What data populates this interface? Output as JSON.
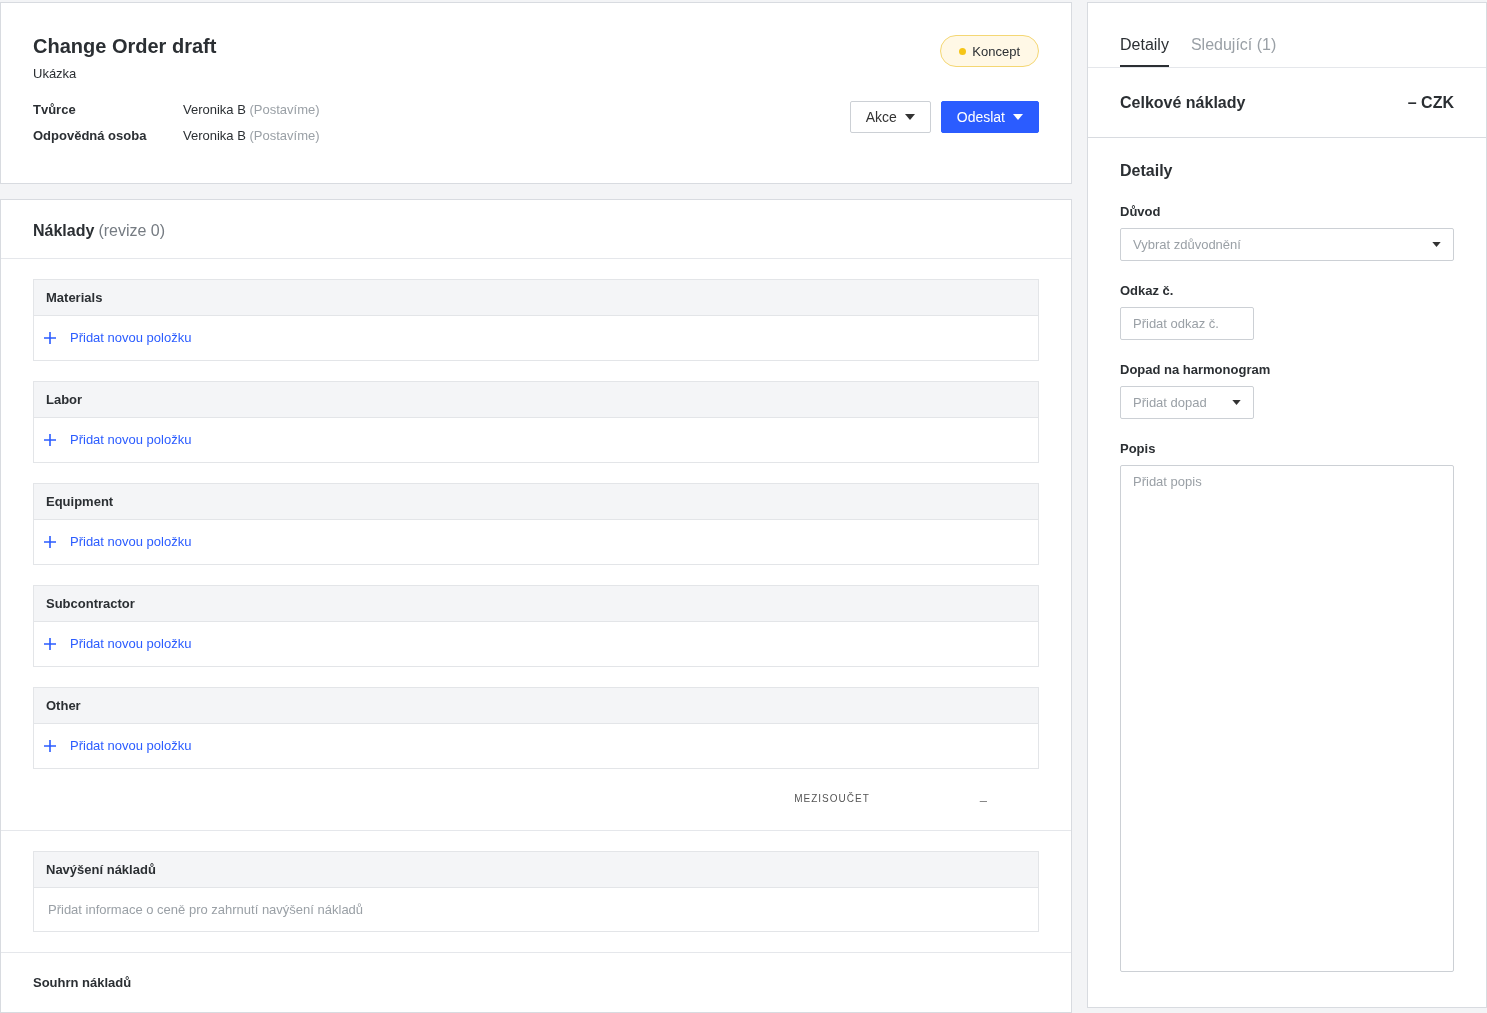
{
  "header": {
    "title": "Change Order draft",
    "subtitle": "Ukázka",
    "status": {
      "label": "Koncept",
      "color": "#f5c518"
    },
    "people": [
      {
        "label": "Tvůrce",
        "name": "Veronika B",
        "company": "(Postavíme)"
      },
      {
        "label": "Odpovědná osoba",
        "name": "Veronika B",
        "company": "(Postavíme)"
      }
    ],
    "buttons": [
      {
        "label": "Akce",
        "kind": "secondary"
      },
      {
        "label": "Odeslat",
        "kind": "primary"
      }
    ]
  },
  "costs": {
    "title": "Náklady",
    "revision": "(revize 0)",
    "groups": [
      {
        "name": "Materials",
        "add_label": "Přidat novou položku"
      },
      {
        "name": "Labor",
        "add_label": "Přidat novou položku"
      },
      {
        "name": "Equipment",
        "add_label": "Přidat novou položku"
      },
      {
        "name": "Subcontractor",
        "add_label": "Přidat novou položku"
      },
      {
        "name": "Other",
        "add_label": "Přidat novou položku"
      }
    ],
    "subtotal": {
      "label": "MEZISOUČET",
      "value": "–"
    },
    "markup": {
      "title": "Navýšení nákladů",
      "hint": "Přidat informace o ceně pro zahrnutí navýšení nákladů"
    },
    "summary_title": "Souhrn nákladů"
  },
  "sidebar": {
    "tabs": [
      {
        "label": "Detaily",
        "selected": true
      },
      {
        "label": "Sledující (1)",
        "selected": false
      }
    ],
    "total": {
      "label": "Celkové náklady",
      "value": "– CZK"
    },
    "details": {
      "title": "Detaily",
      "fields": [
        {
          "label": "Důvod",
          "kind": "select",
          "placeholder": "Vybrat zdůvodnění"
        },
        {
          "label": "Odkaz č.",
          "kind": "input",
          "placeholder": "Přidat odkaz č."
        },
        {
          "label": "Dopad na harmonogram",
          "kind": "select",
          "placeholder": "Přidat dopad"
        },
        {
          "label": "Popis",
          "kind": "textarea",
          "placeholder": "Přidat popis"
        }
      ]
    }
  }
}
